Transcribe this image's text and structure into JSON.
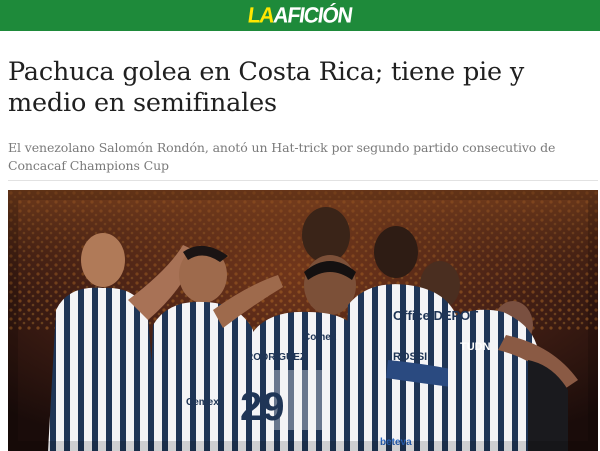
{
  "site": {
    "logo_prefix": "LA",
    "logo_main": "AFICIÓN",
    "brand_green": "#1e8a3a",
    "logo_accent": "#ffe600"
  },
  "article": {
    "headline": "Pachuca golea en Costa Rica; tiene pie y medio en semifinales",
    "subheadline": "El venezolano Salomón Rondón, anotó un Hat-trick por segundo partido consecutivo de Concacaf Champions Cup"
  },
  "hero_photo": {
    "jersey_texts": [
      "Cemex",
      "Office DEPOT",
      "TUDN",
      "RODRIGUEZ",
      "29",
      "ROSSI",
      "Comex",
      "beteva"
    ]
  }
}
